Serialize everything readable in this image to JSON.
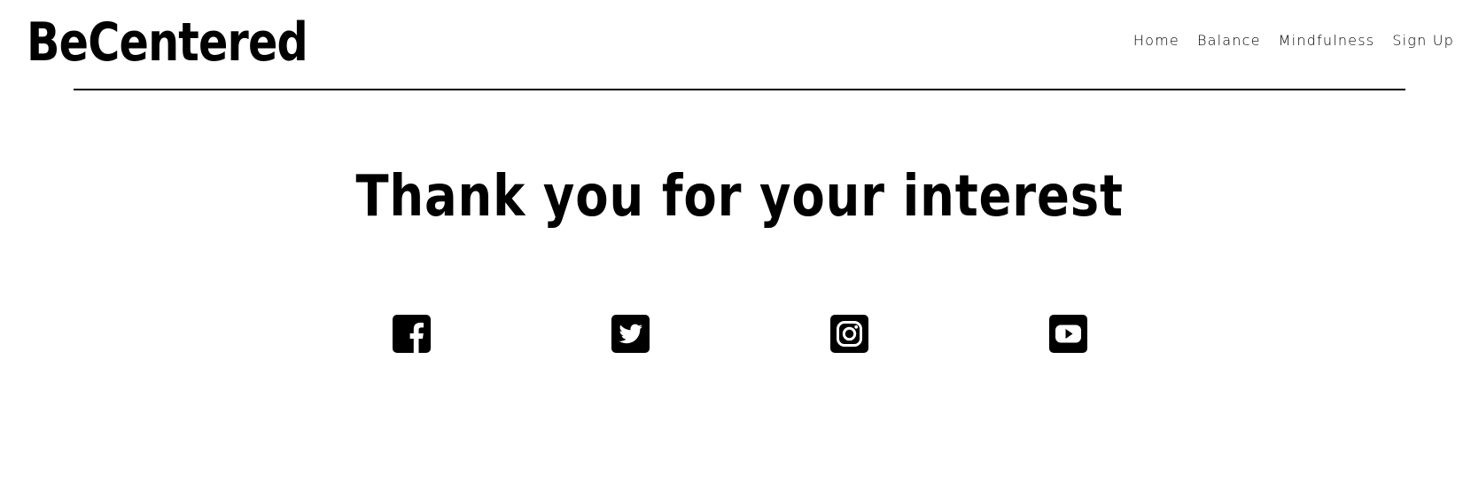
{
  "brand": {
    "name": "BeCentered"
  },
  "nav": {
    "items": [
      {
        "label": "Home"
      },
      {
        "label": "Balance"
      },
      {
        "label": "Mindfulness"
      },
      {
        "label": "Sign Up"
      }
    ]
  },
  "main": {
    "heading": "Thank you for your interest"
  },
  "social": {
    "icons": [
      "facebook-icon",
      "twitter-icon",
      "instagram-icon",
      "youtube-icon"
    ]
  },
  "colors": {
    "text": "#000000",
    "background": "#ffffff"
  }
}
